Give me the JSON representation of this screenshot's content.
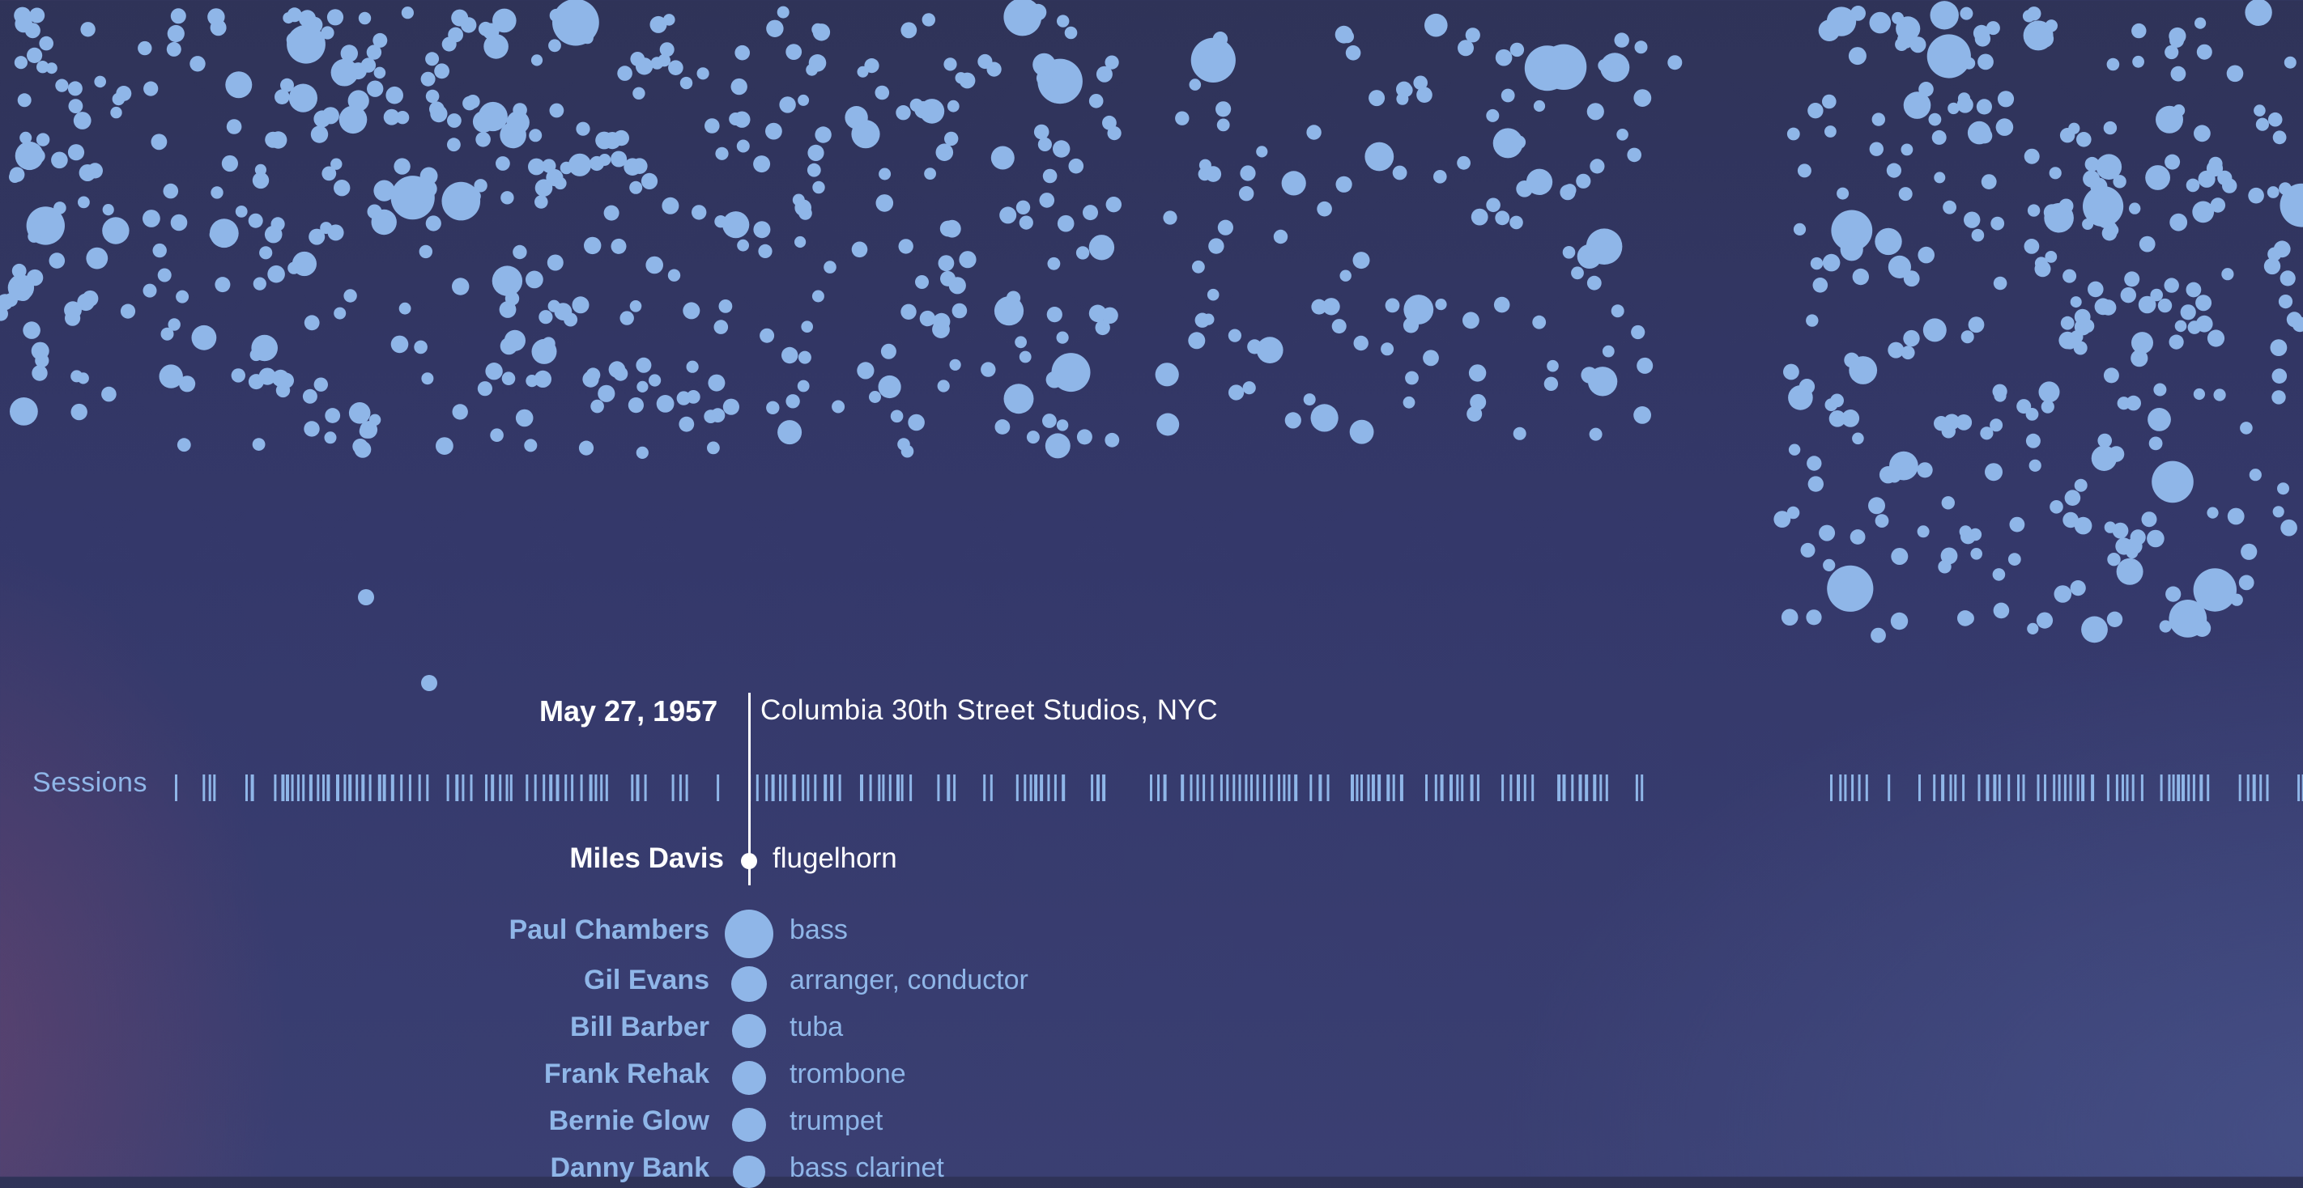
{
  "session": {
    "date": "May 27, 1957",
    "venue": "Columbia 30th Street Studios, NYC",
    "timeline_label": "Sessions"
  },
  "leader": {
    "name": "Miles Davis",
    "instrument": "flugelhorn"
  },
  "members": [
    {
      "name": "Paul Chambers",
      "instrument": "bass",
      "weight": 1.0
    },
    {
      "name": "Gil Evans",
      "instrument": "arranger, conductor",
      "weight": 0.6
    },
    {
      "name": "Bill Barber",
      "instrument": "tuba",
      "weight": 0.55
    },
    {
      "name": "Frank Rehak",
      "instrument": "trombone",
      "weight": 0.55
    },
    {
      "name": "Bernie Glow",
      "instrument": "trumpet",
      "weight": 0.55
    },
    {
      "name": "Danny Bank",
      "instrument": "bass clarinet",
      "weight": 0.5
    }
  ],
  "colors": {
    "accent": "#8fb6e8",
    "highlight": "#ffffff",
    "background": "#34386a"
  }
}
